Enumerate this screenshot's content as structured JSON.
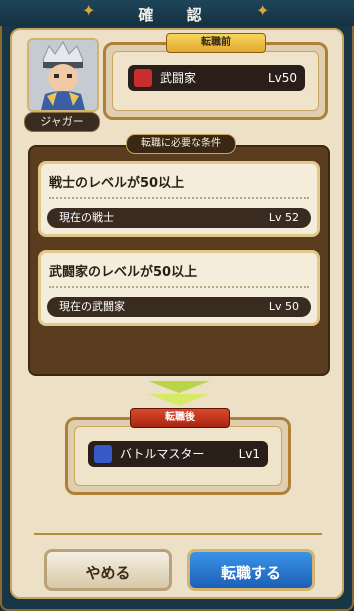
{
  "dialog": {
    "title": "確 認"
  },
  "character": {
    "name": "ジャガー"
  },
  "current_job": {
    "badge": "転職前",
    "name": "武闘家",
    "level": "Lv50",
    "icon": "fighter-job-icon"
  },
  "conditions": {
    "header": "転職に必要な条件",
    "items": [
      {
        "text": "戦士のレベルが50以上",
        "status_label": "現在の戦士",
        "status_value": "Lv 52"
      },
      {
        "text": "武闘家のレベルが50以上",
        "status_label": "現在の武闘家",
        "status_value": "Lv 50"
      }
    ]
  },
  "new_job": {
    "badge": "転職後",
    "name": "バトルマスター",
    "level": "Lv1",
    "icon": "battle-master-job-icon"
  },
  "buttons": {
    "cancel": "やめる",
    "confirm": "転職する"
  },
  "colors": {
    "confirm_button": "#2a7ad6",
    "dialog_header": "#1d4558",
    "badge_gold": "#e2a82d",
    "badge_red": "#c13a20"
  }
}
